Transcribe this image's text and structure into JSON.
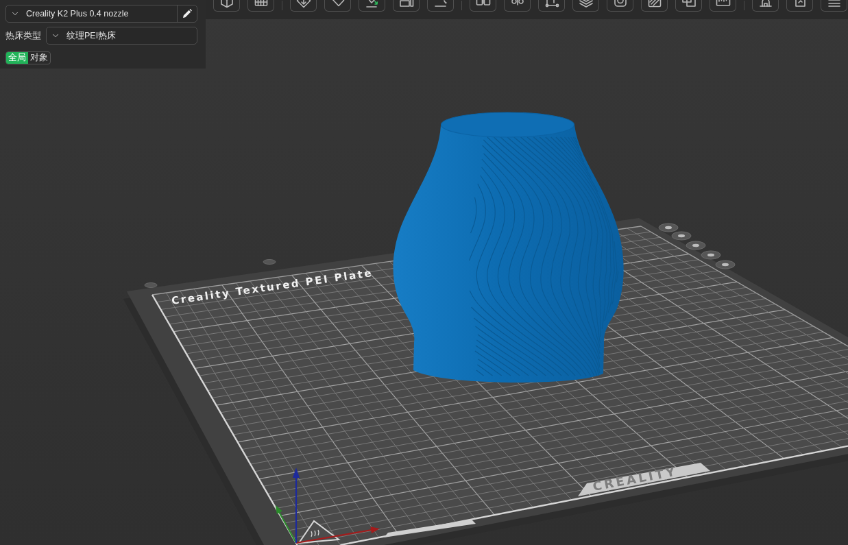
{
  "printer_panel": {
    "printer_select": {
      "value": "Creality K2 Plus 0.4 nozzle"
    },
    "bed_type": {
      "label": "热床类型",
      "value": "纹理PEI热床"
    },
    "scope_toggle": [
      {
        "label": "全局",
        "selected": true
      },
      {
        "label": "对象",
        "selected": false
      }
    ]
  },
  "viewport": {
    "plate_label": "Creality Textured PEI Plate",
    "brand_label": "CREALITY"
  }
}
